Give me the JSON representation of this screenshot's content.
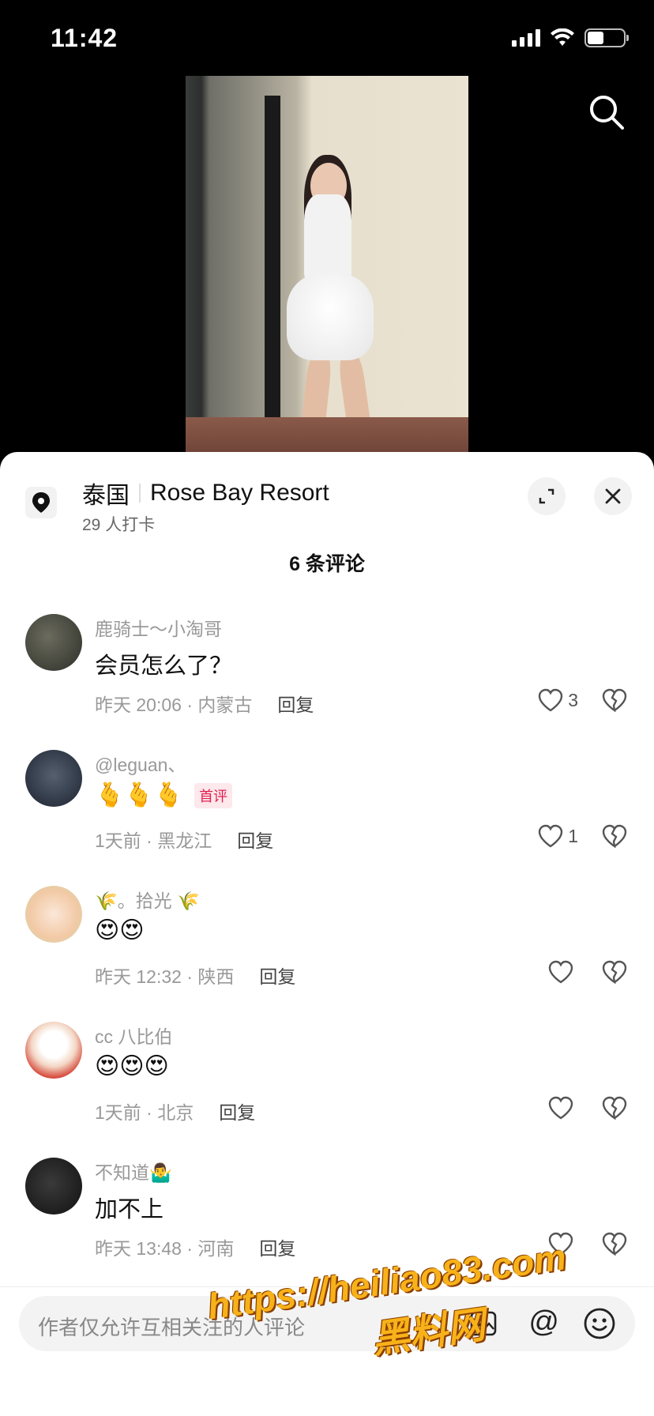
{
  "status_bar": {
    "time": "11:42",
    "battery_level": 0.45
  },
  "location": {
    "country": "泰国",
    "place": "Rose Bay Resort",
    "checkins": "29 人打卡"
  },
  "comments_header": "6 条评论",
  "comments": [
    {
      "user": "鹿骑士～小淘哥",
      "text": "会员怎么了？",
      "time_loc": "昨天 20:06 · 内蒙古",
      "reply": "回复",
      "likes": "3"
    },
    {
      "user": "@leguan、",
      "text": "🫰🫰🫰",
      "badge": "首评",
      "time_loc": "1天前 · 黑龙江",
      "reply": "回复",
      "likes": "1"
    },
    {
      "user": "🌾。拾光 🌾",
      "text": "😍😍",
      "time_loc": "昨天 12:32 · 陕西",
      "reply": "回复",
      "likes": ""
    },
    {
      "user": "cc 八比伯",
      "text": "😍😍😍",
      "time_loc": "1天前 · 北京",
      "reply": "回复",
      "likes": ""
    },
    {
      "user": "不知道🤷‍♂️",
      "text": "加不上",
      "time_loc": "昨天 13:48 · 河南",
      "reply": "回复",
      "likes": ""
    }
  ],
  "input": {
    "placeholder": "作者仅允许互相关注的人评论"
  },
  "watermark": {
    "url": "https://heiliao83.com",
    "cn": "黑料网"
  }
}
